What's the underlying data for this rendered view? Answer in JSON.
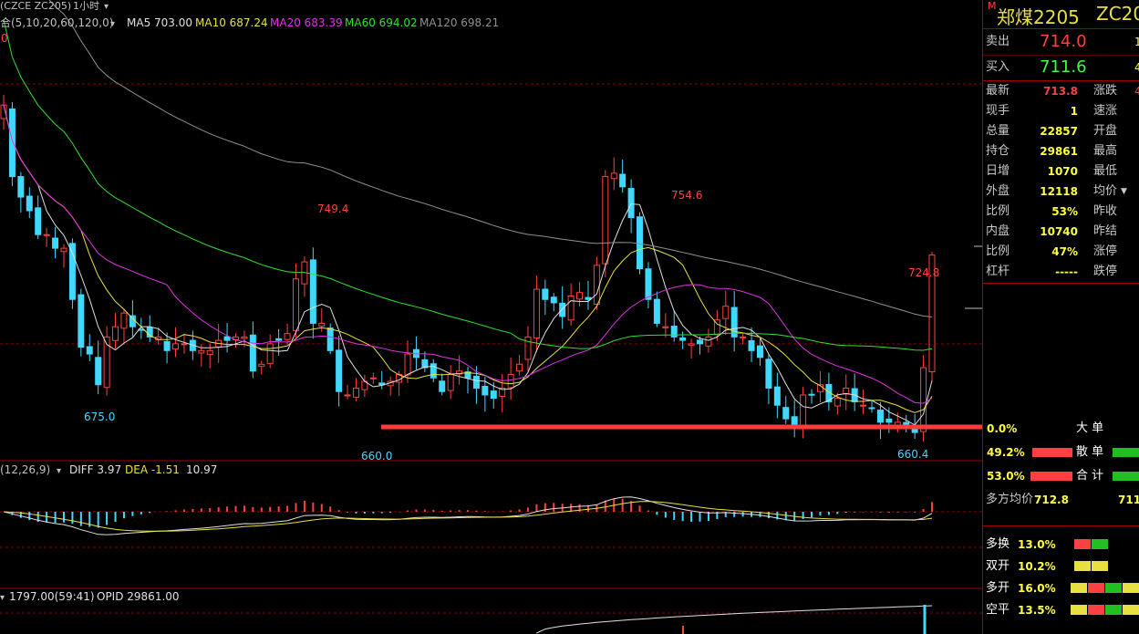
{
  "header": {
    "indicator_label": "合(5,10,20,60,120,0)",
    "ma5": "MA5 703.00",
    "ma10": "MA10 687.24",
    "ma20": "MA20 683.39",
    "ma60": "MA60 694.02",
    "ma120": "MA120 698.21",
    "symbol_code": "(CZCE ZC205)",
    "period": "1小时",
    "zero_marker": "0"
  },
  "annotations": {
    "high1": "749.4",
    "high2": "754.6",
    "high3": "724.8",
    "low1": "675.0",
    "low2": "660.0",
    "low3": "660.4",
    "pct": "0.0%"
  },
  "macd": {
    "label": "(12,26,9)",
    "diff": "DIFF 3.97",
    "dea": "DEA -1.51",
    "macd": "10.97"
  },
  "opi": {
    "vol": "1797.00(59:41)",
    "opid": "OPID 29861.00"
  },
  "quote": {
    "m_tag": "M",
    "name": "郑煤2205",
    "code": "ZC20",
    "sell_label": "卖出",
    "sell_price": "714.0",
    "buy_label": "买入",
    "buy_price": "711.6",
    "buy_right": "4",
    "sell_right": "1",
    "rows": [
      {
        "label": "最新",
        "value": "713.8",
        "color": "#ff4040",
        "label2": "涨跌",
        "right": "4"
      },
      {
        "label": "现手",
        "value": "1",
        "color": "#ffff40",
        "label2": "速涨",
        "right": ""
      },
      {
        "label": "总量",
        "value": "22857",
        "color": "#ffff40",
        "label2": "开盘",
        "right": ""
      },
      {
        "label": "持仓",
        "value": "29861",
        "color": "#ffff40",
        "label2": "最高",
        "right": ""
      },
      {
        "label": "日增",
        "value": "1070",
        "color": "#ffff40",
        "label2": "最低",
        "right": ""
      },
      {
        "label": "外盘",
        "value": "12118",
        "color": "#ffff40",
        "label2": "均价",
        "right": ""
      },
      {
        "label": "比例",
        "value": "53%",
        "color": "#ffff40",
        "label2": "昨收",
        "right": ""
      },
      {
        "label": "内盘",
        "value": "10740",
        "color": "#ffff40",
        "label2": "昨结",
        "right": ""
      },
      {
        "label": "比例",
        "value": "47%",
        "color": "#ffff40",
        "label2": "涨停",
        "right": ""
      },
      {
        "label": "杠杆",
        "value": "-----",
        "color": "#ffff40",
        "label2": "跌停",
        "right": ""
      }
    ],
    "flow": [
      {
        "pct": "0.0%",
        "label": "大 单"
      },
      {
        "pct": "49.2%",
        "label": "散 单"
      },
      {
        "pct": "53.0%",
        "label": "合 计"
      }
    ],
    "avg_label": "多方均价",
    "avg_value": "712.8",
    "avg_right": "711",
    "trades": [
      {
        "label": "多换",
        "pct": "13.0%"
      },
      {
        "label": "双开",
        "pct": "10.2%"
      },
      {
        "label": "多开",
        "pct": "16.0%"
      },
      {
        "label": "空平",
        "pct": "13.5%"
      }
    ]
  },
  "chart_data": {
    "type": "candlestick",
    "series_names": [
      "MA5",
      "MA10",
      "MA20",
      "MA60",
      "MA120"
    ],
    "ylim": [
      654,
      777
    ],
    "support_level": 660,
    "close": [
      758,
      737,
      731,
      727,
      720,
      720,
      716,
      716,
      701,
      687,
      685,
      676,
      690,
      693,
      697,
      693,
      692,
      690,
      690,
      686,
      688,
      688,
      686,
      686,
      686,
      689,
      689,
      690,
      690,
      680,
      682,
      688,
      689,
      691,
      707,
      712,
      694,
      694,
      686,
      674,
      673,
      675,
      677,
      678,
      676,
      677,
      679,
      685,
      684,
      681,
      678,
      674,
      679,
      680,
      678,
      675,
      673,
      672,
      675,
      679,
      682,
      690,
      704,
      701,
      700,
      696,
      702,
      703,
      701,
      711,
      737,
      738,
      734,
      725,
      710,
      701,
      694,
      693,
      690,
      689,
      688,
      688,
      690,
      695,
      699,
      690,
      690,
      686,
      684,
      675,
      670,
      666,
      664,
      673,
      673,
      676,
      671,
      672,
      675,
      671,
      670,
      669,
      665,
      665,
      665,
      664,
      662,
      681,
      714
    ]
  }
}
